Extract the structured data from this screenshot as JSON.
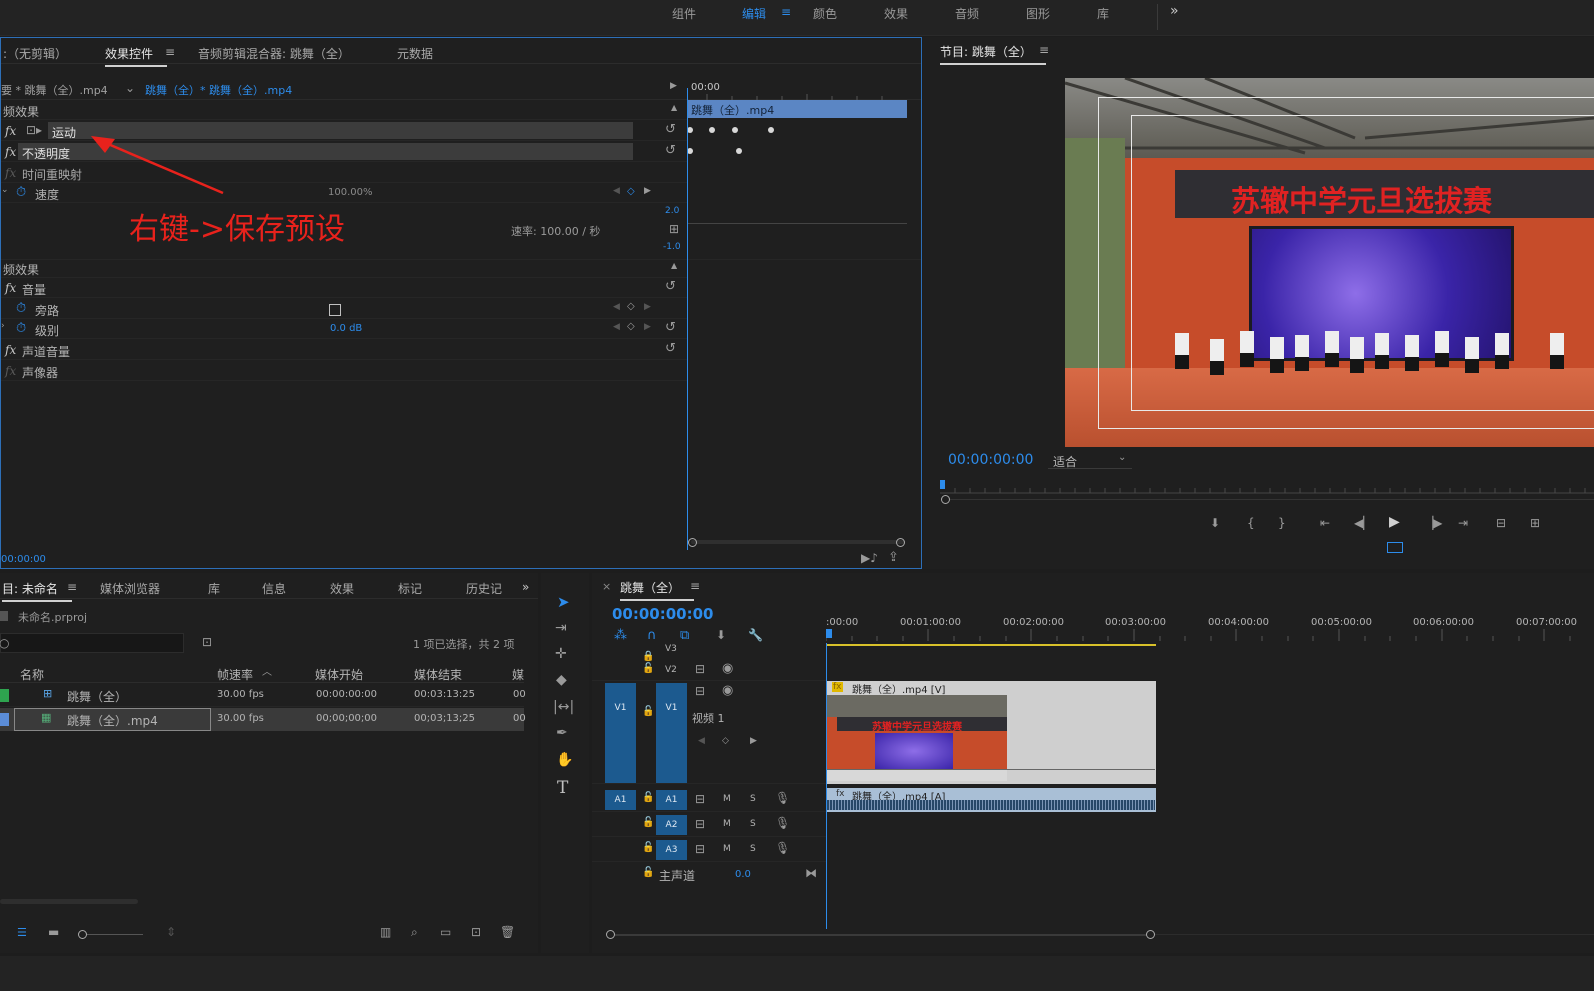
{
  "workspaces": {
    "items": [
      "组件",
      "编辑",
      "颜色",
      "效果",
      "音频",
      "图形",
      "库"
    ],
    "more": "»"
  },
  "effect_controls": {
    "tabs": [
      ":（无剪辑）",
      "效果控件",
      "音频剪辑混合器: 跳舞（全）",
      "元数据"
    ],
    "tab_menu": "≡",
    "master_clip": "要 * 跳舞（全）.mp4",
    "clip_path": "跳舞（全）* 跳舞（全）.mp4",
    "video_section": "频效果",
    "motion": "运动",
    "opacity": "不透明度",
    "time_remap": "时间重映射",
    "speed_label": "速度",
    "speed_value": "100.00%",
    "axis_top": "2.0",
    "axis_bottom": "-1.0",
    "rate_label": "速率: 100.00 / 秒",
    "audio_section": "频效果",
    "volume": "音量",
    "bypass": "旁路",
    "level": "级别",
    "level_value": "0.0 dB",
    "channel_volume": "声道音量",
    "panner": "声像器",
    "timecode": "00:00:00",
    "mini_ruler": "00:00",
    "mini_clip": "跳舞（全）.mp4",
    "annotation": "右键->保存预设",
    "annotation_color": "#e8221c"
  },
  "program": {
    "title": "节目: 跳舞（全）",
    "menu": "≡",
    "timecode": "00:00:00:00",
    "fit": "适合",
    "video_banner": "苏辙中学元旦选拔赛"
  },
  "project": {
    "tabs": [
      "目: 未命名",
      "媒体浏览器",
      "库",
      "信息",
      "效果",
      "标记",
      "历史记"
    ],
    "more": "»",
    "file": "未命名.prproj",
    "selection_info": "1 项已选择，共 2 项",
    "columns": [
      "名称",
      "帧速率",
      "媒体开始",
      "媒体结束",
      "媒"
    ],
    "rows": [
      {
        "name": "跳舞（全）",
        "fps": "30.00 fps",
        "start": "00:00:00:00",
        "end": "00:03:13:25",
        "extra": "00"
      },
      {
        "name": "跳舞（全）.mp4",
        "fps": "30.00 fps",
        "start": "00;00;00;00",
        "end": "00;03;13;25",
        "extra": "00"
      }
    ]
  },
  "timeline": {
    "close": "×",
    "title": "跳舞（全）",
    "menu": "≡",
    "timecode": "00:00:00:00",
    "ruler": [
      ":00:00",
      "00:01:00:00",
      "00:02:00:00",
      "00:03:00:00",
      "00:04:00:00",
      "00:05:00:00",
      "00:06:00:00",
      "00:07:00:00"
    ],
    "tracks": {
      "v3": "V3",
      "v2": "V2",
      "v1": "V1",
      "video1": "视频 1",
      "a1": "A1",
      "a2": "A2",
      "a3": "A3",
      "master": "主声道",
      "master_value": "0.0",
      "m": "M",
      "s": "S"
    },
    "video_clip": "跳舞（全）.mp4 [V]",
    "audio_clip": "跳舞（全）.mp4 [A]",
    "fx_badge": "fx"
  }
}
